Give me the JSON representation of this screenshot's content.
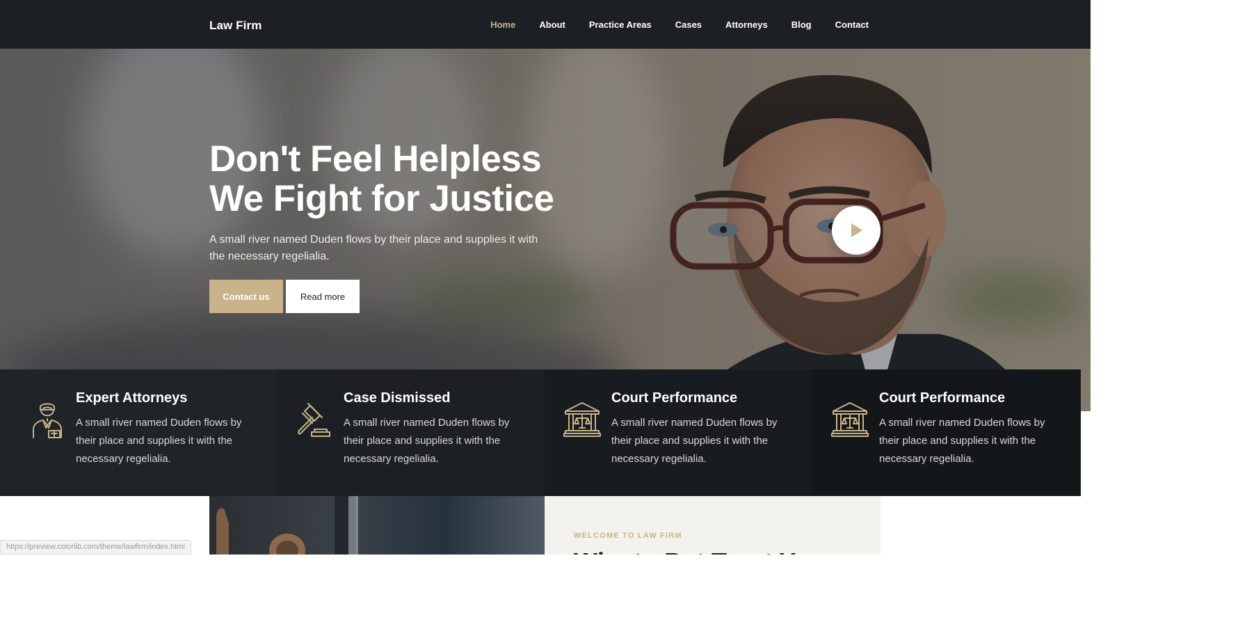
{
  "brand": "Law Firm",
  "nav": {
    "items": [
      "Home",
      "About",
      "Practice Areas",
      "Cases",
      "Attorneys",
      "Blog",
      "Contact"
    ],
    "active": "Home"
  },
  "hero": {
    "title_line1": "Don't Feel Helpless",
    "title_line2": "We Fight for Justice",
    "subtitle": "A small river named Duden flows by their place and supplies it with the necessary regelialia.",
    "primary_button": "Contact us",
    "secondary_button": "Read more",
    "play_icon": "play-icon"
  },
  "features": [
    {
      "icon": "attorney-icon",
      "title": "Expert Attorneys",
      "text": "A small river named Duden flows by their place and supplies it with the necessary regelialia."
    },
    {
      "icon": "gavel-icon",
      "title": "Case Dismissed",
      "text": "A small river named Duden flows by their place and supplies it with the necessary regelialia."
    },
    {
      "icon": "courthouse-icon",
      "title": "Court Performance",
      "text": "A small river named Duden flows by their place and supplies it with the necessary regelialia."
    },
    {
      "icon": "courthouse-icon",
      "title": "Court Performance",
      "text": "A small river named Duden flows by their place and supplies it with the necessary regelialia."
    }
  ],
  "about": {
    "kicker": "WELCOME TO LAW FIRM",
    "heading": "Why to Put Trust Y"
  },
  "status_url": "https://preview.colorlib.com/theme/lawfirm/index.html",
  "colors": {
    "accent": "#c9b38a",
    "navbar": "#1c2025",
    "panel": "#f4f2ee"
  }
}
